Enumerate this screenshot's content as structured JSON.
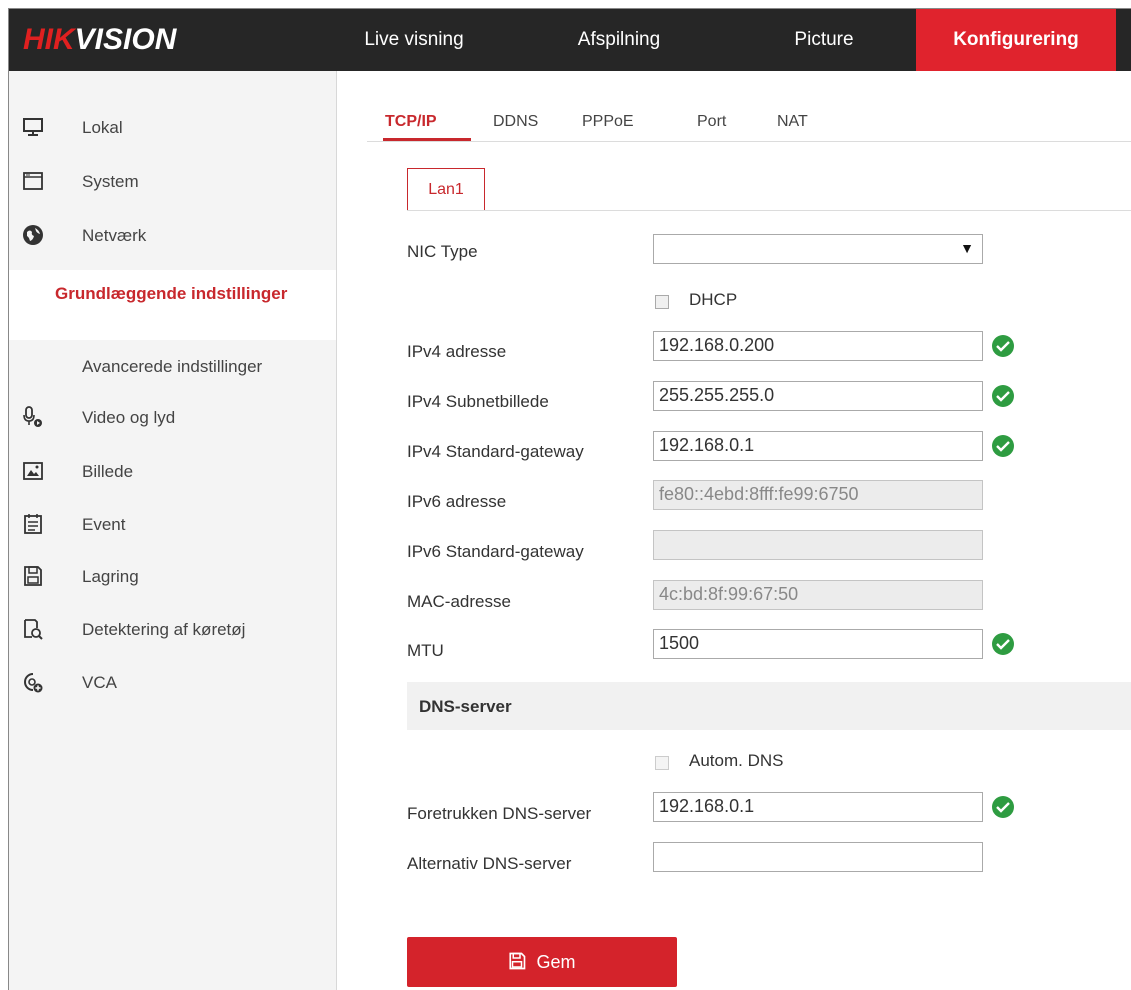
{
  "brand": {
    "hik": "HIK",
    "vision": "VISION"
  },
  "nav": {
    "live": "Live visning",
    "playback": "Afspilning",
    "picture": "Picture",
    "config": "Konfigurering"
  },
  "sidebar": {
    "items": [
      {
        "label": "Lokal",
        "icon": "monitor-icon"
      },
      {
        "label": "System",
        "icon": "window-icon"
      },
      {
        "label": "Netværk",
        "icon": "globe-icon"
      },
      {
        "label": "Video og lyd",
        "icon": "microphone-icon"
      },
      {
        "label": "Billede",
        "icon": "image-icon"
      },
      {
        "label": "Event",
        "icon": "calendar-icon"
      },
      {
        "label": "Lagring",
        "icon": "save-icon"
      },
      {
        "label": "Detektering af køretøj",
        "icon": "vehicle-detect-icon"
      },
      {
        "label": "VCA",
        "icon": "vca-icon"
      }
    ],
    "sub_active": "Grundlæggende indstillinger",
    "sub_advanced": "Avancerede indstillinger"
  },
  "tabs": {
    "tcpip": "TCP/IP",
    "ddns": "DDNS",
    "pppoe": "PPPoE",
    "port": "Port",
    "nat": "NAT"
  },
  "lan_tab": "Lan1",
  "form": {
    "nic_type": {
      "label": "NIC Type",
      "value": ""
    },
    "dhcp": {
      "label": "DHCP",
      "checked": false
    },
    "ipv4_address": {
      "label": "IPv4 adresse",
      "value": "192.168.0.200"
    },
    "ipv4_subnet": {
      "label": "IPv4 Subnetbillede",
      "value": "255.255.255.0"
    },
    "ipv4_gateway": {
      "label": "IPv4 Standard-gateway",
      "value": "192.168.0.1"
    },
    "ipv6_address": {
      "label": "IPv6 adresse",
      "value": "fe80::4ebd:8fff:fe99:6750"
    },
    "ipv6_gateway": {
      "label": "IPv6 Standard-gateway",
      "value": ""
    },
    "mac": {
      "label": "MAC-adresse",
      "value": "4c:bd:8f:99:67:50"
    },
    "mtu": {
      "label": "MTU",
      "value": "1500"
    }
  },
  "dns": {
    "section_title": "DNS-server",
    "auto_dns": {
      "label": "Autom. DNS",
      "checked": false
    },
    "preferred": {
      "label": "Foretrukken DNS-server",
      "value": "192.168.0.1"
    },
    "alternate": {
      "label": "Alternativ DNS-server",
      "value": ""
    }
  },
  "save_label": "Gem",
  "colors": {
    "accent": "#e0232d",
    "ok": "#2e9c41",
    "topbar": "#262626"
  }
}
